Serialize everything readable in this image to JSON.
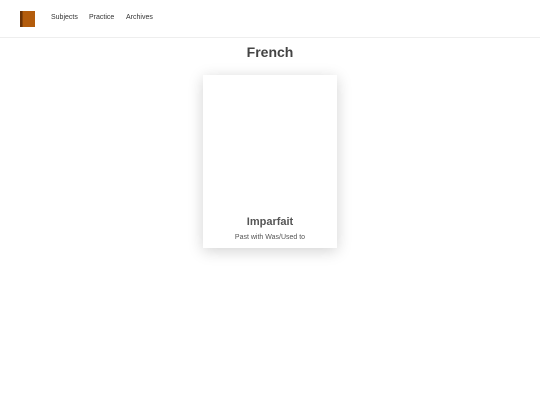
{
  "nav": {
    "logo_icon": "book-icon",
    "items": [
      {
        "label": "Subjects"
      },
      {
        "label": "Practice"
      },
      {
        "label": "Archives"
      }
    ]
  },
  "page": {
    "title": "French"
  },
  "cards": [
    {
      "title": "Imparfait",
      "subtitle": "Past with Was/Used to"
    }
  ],
  "colors": {
    "book_cover": "#b35c0c",
    "book_spine": "#6b3306",
    "text": "#333333"
  }
}
